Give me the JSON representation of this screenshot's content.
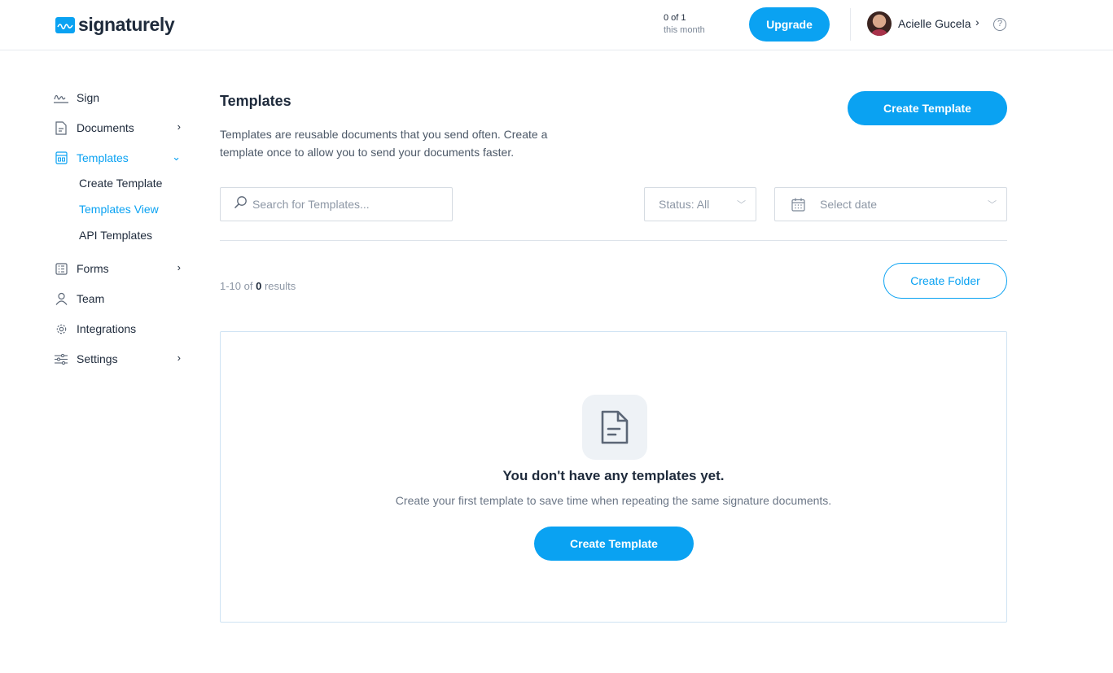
{
  "brand": {
    "name": "signaturely",
    "accent": "#0aa2f2"
  },
  "header": {
    "usage_count": "0 of 1",
    "usage_period": "this month",
    "upgrade_label": "Upgrade",
    "user_name": "Acielle Gucela",
    "user_chevron": "›",
    "help_glyph": "?"
  },
  "sidebar": {
    "items": [
      {
        "label": "Sign",
        "icon": "signature-icon"
      },
      {
        "label": "Documents",
        "icon": "document-icon",
        "chevron": "›"
      },
      {
        "label": "Templates",
        "icon": "templates-icon",
        "chevron": "⌄",
        "active": true
      },
      {
        "label": "Forms",
        "icon": "forms-icon",
        "chevron": "›"
      },
      {
        "label": "Team",
        "icon": "user-icon"
      },
      {
        "label": "Integrations",
        "icon": "gear-icon"
      },
      {
        "label": "Settings",
        "icon": "sliders-icon",
        "chevron": "›"
      }
    ],
    "subitems": [
      {
        "label": "Create Template"
      },
      {
        "label": "Templates View",
        "active": true
      },
      {
        "label": "API Templates"
      }
    ]
  },
  "main": {
    "title": "Templates",
    "description": "Templates are reusable documents that you send often. Create a template once to allow you to send your documents faster.",
    "create_template_label": "Create Template",
    "search_placeholder": "Search for Templates...",
    "status_filter": "Status: All",
    "date_placeholder": "Select date",
    "results_prefix": "1-10 of",
    "results_count": "0",
    "results_suffix": "results",
    "create_folder_label": "Create Folder",
    "empty": {
      "title": "You don't have any templates yet.",
      "description": "Create your first template to save time when repeating the same signature documents.",
      "button_label": "Create Template"
    }
  }
}
